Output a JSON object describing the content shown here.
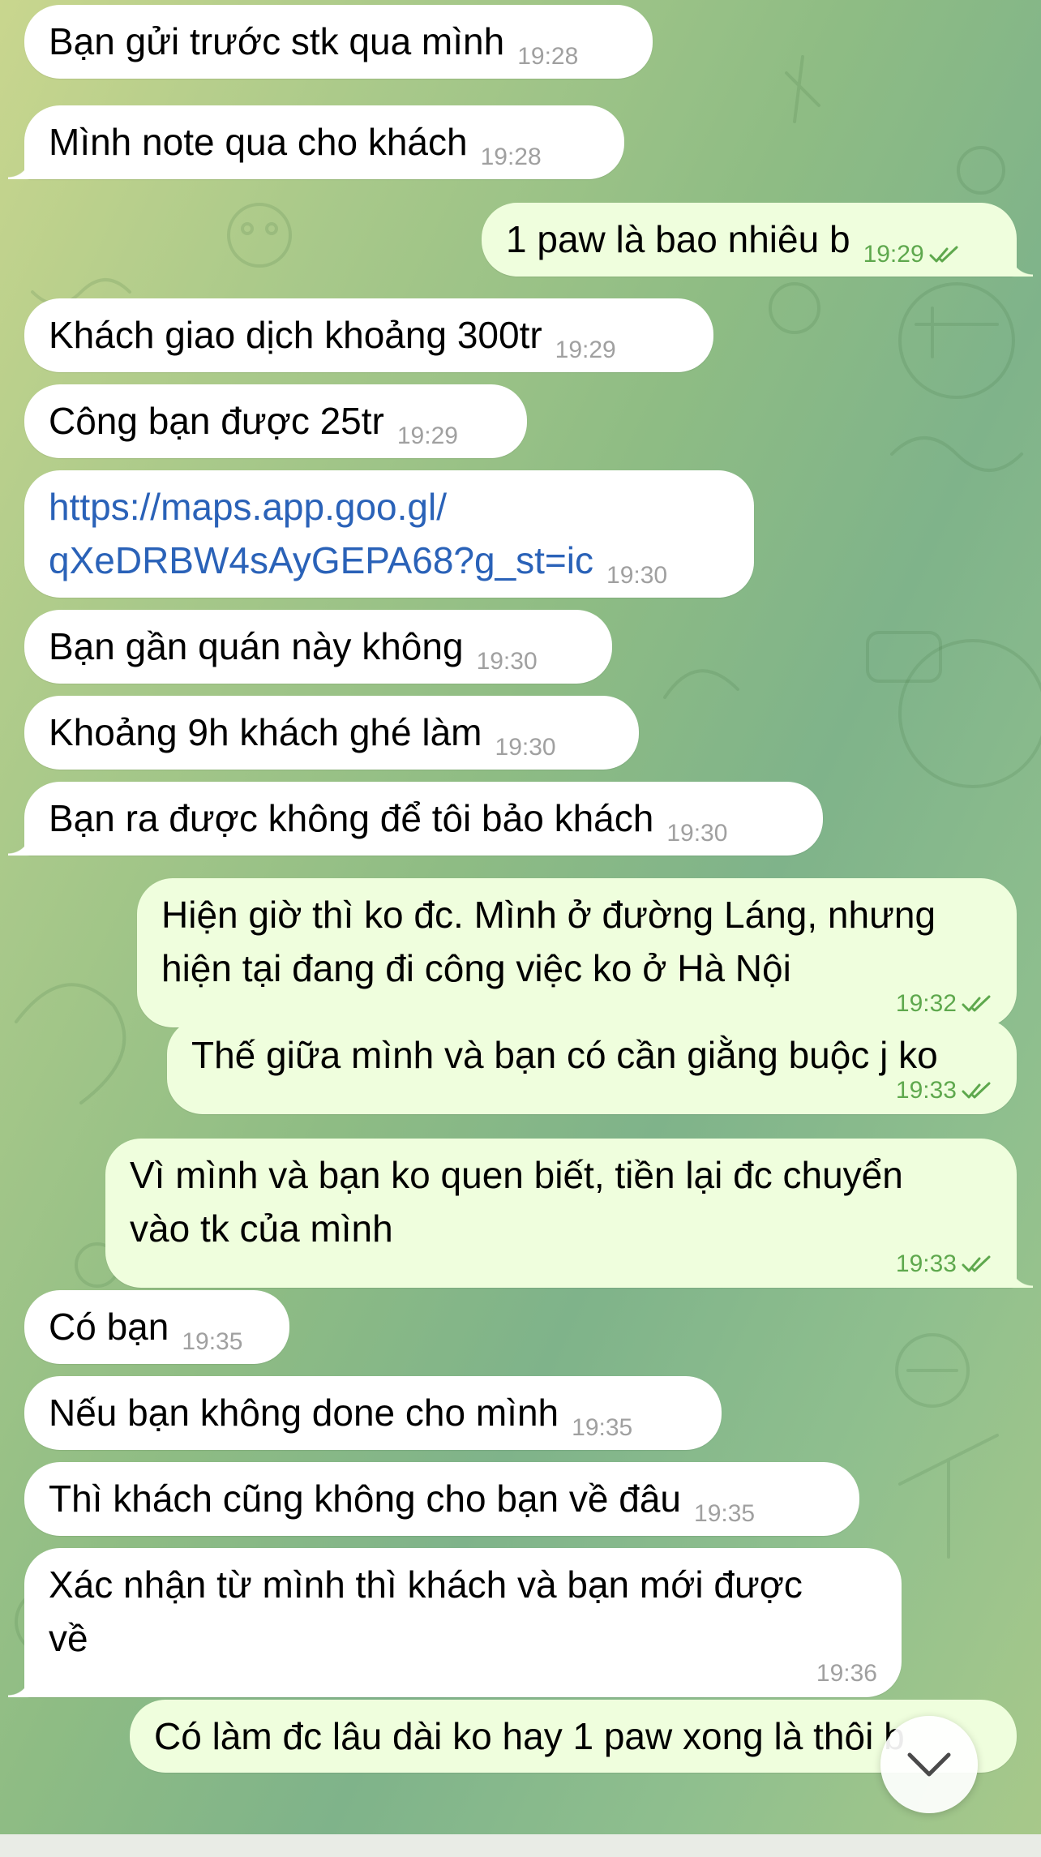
{
  "messages": [
    {
      "dir": "in",
      "text": "Bạn gửi trước stk qua mình",
      "time": "19:28"
    },
    {
      "dir": "in",
      "text": "Mình note qua cho khách",
      "time": "19:28"
    },
    {
      "dir": "out",
      "text": "1 paw là bao nhiêu b",
      "time": "19:29"
    },
    {
      "dir": "in",
      "text": "Khách giao dịch khoảng 300tr",
      "time": "19:29"
    },
    {
      "dir": "in",
      "text": "Công bạn được 25tr",
      "time": "19:29"
    },
    {
      "dir": "in",
      "text": "https://maps.app.goo.gl/\nqXeDRBW4sAyGEPA68?g_st=ic",
      "time": "19:30"
    },
    {
      "dir": "in",
      "text": "Bạn gần quán này không",
      "time": "19:30"
    },
    {
      "dir": "in",
      "text": "Khoảng 9h khách ghé làm",
      "time": "19:30"
    },
    {
      "dir": "in",
      "text": "Bạn ra được không để tôi bảo khách",
      "time": "19:30"
    },
    {
      "dir": "out",
      "text": "Hiện giờ thì ko đc. Mình ở đường Láng, nhưng\nhiện tại đang đi công việc ko ở Hà Nội",
      "time": "19:32"
    },
    {
      "dir": "out",
      "text": "Thế giữa mình và bạn có cần giằng buộc j ko",
      "time": "19:33"
    },
    {
      "dir": "out",
      "text": "Vì mình và bạn ko quen biết, tiền lại đc chuyển\nvào tk của mình",
      "time": "19:33"
    },
    {
      "dir": "in",
      "text": "Có bạn",
      "time": "19:35"
    },
    {
      "dir": "in",
      "text": "Nếu bạn không done cho mình",
      "time": "19:35"
    },
    {
      "dir": "in",
      "text": "Thì khách cũng không cho bạn về đâu",
      "time": "19:35"
    },
    {
      "dir": "in",
      "text": "Xác nhận từ mình thì khách và bạn mới được\nvề",
      "time": "19:36"
    },
    {
      "dir": "out",
      "text": "Có làm đc lâu dài ko hay 1 paw xong là thôi b",
      "time": ""
    }
  ],
  "colors": {
    "incoming_bubble": "#ffffff",
    "outgoing_bubble": "#effedd",
    "outgoing_meta": "#5ea84d",
    "incoming_meta": "#a0a0a0",
    "link": "#2a62b8"
  },
  "icons": {
    "read_receipt": "double-check-icon",
    "scroll_down": "chevron-down-icon"
  }
}
